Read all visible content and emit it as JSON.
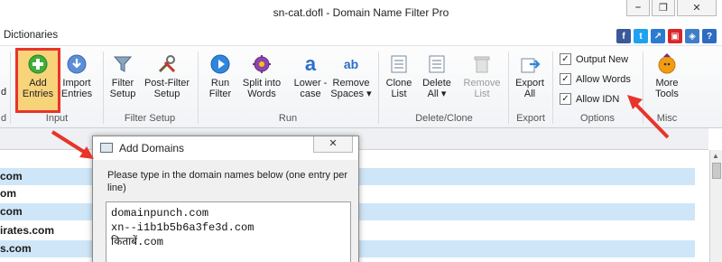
{
  "window": {
    "title": "sn-cat.dofl - Domain Name Filter Pro",
    "minimize_glyph": "⎯",
    "restore_glyph": "❐",
    "close_glyph": "✕"
  },
  "menu": {
    "dictionaries": "Dictionaries"
  },
  "social": [
    {
      "icon": "facebook-icon",
      "glyph": "f",
      "color": "#3b5998"
    },
    {
      "icon": "twitter-icon",
      "glyph": "t",
      "color": "#1da1f2"
    },
    {
      "icon": "share-icon",
      "glyph": "↗",
      "color": "#2a7bd1"
    },
    {
      "icon": "box-icon",
      "glyph": "▣",
      "color": "#d7262a"
    },
    {
      "icon": "cube-icon",
      "glyph": "◈",
      "color": "#3e7ec9"
    },
    {
      "icon": "help-icon",
      "glyph": "?",
      "color": "#2e6bc2"
    }
  ],
  "ribbon": {
    "tools": {
      "cut_left": "d",
      "add_entries": "Add Entries",
      "import_entries": "Import Entries",
      "filter_setup": "Filter Setup",
      "post_filter_setup": "Post-Filter Setup",
      "run_filter": "Run Filter",
      "split_into_words": "Split into Words",
      "lowercase": "Lower -case",
      "remove_spaces": "Remove Spaces ▾",
      "clone_list": "Clone List",
      "delete_all": "Delete All ▾",
      "remove_list": "Remove List",
      "export_all": "Export All",
      "more_tools": "More Tools"
    },
    "groups": {
      "cut_left": "d",
      "input": "Input",
      "filter_setup": "Filter Setup",
      "run": "Run",
      "delete_clone": "Delete/Clone",
      "export": "Export",
      "options": "Options",
      "misc": "Misc"
    },
    "options": {
      "output_new": "Output New",
      "allow_words": "Allow Words",
      "allow_idn": "Allow IDN",
      "check": "✓"
    }
  },
  "grid_rows": [
    {
      "text": "com",
      "style": "alt"
    },
    {
      "text": "om",
      "style": "plain"
    },
    {
      "text": "com",
      "style": "alt"
    },
    {
      "text": "irates.com",
      "style": "plain"
    },
    {
      "text": "s.com",
      "style": "alt"
    }
  ],
  "dialog": {
    "title": "Add Domains",
    "close_glyph": "✕",
    "prompt": "Please type in the domain names below (one entry per line)",
    "entries": [
      "domainpunch.com",
      "xn--i1b1b5b6a3fe3d.com",
      "किताबें.com"
    ]
  },
  "colors": {
    "highlight_border": "#e8342a",
    "highlight_fill": "#f7d37a",
    "arrow": "#e8342a",
    "row_alt": "#cfe6f8"
  }
}
